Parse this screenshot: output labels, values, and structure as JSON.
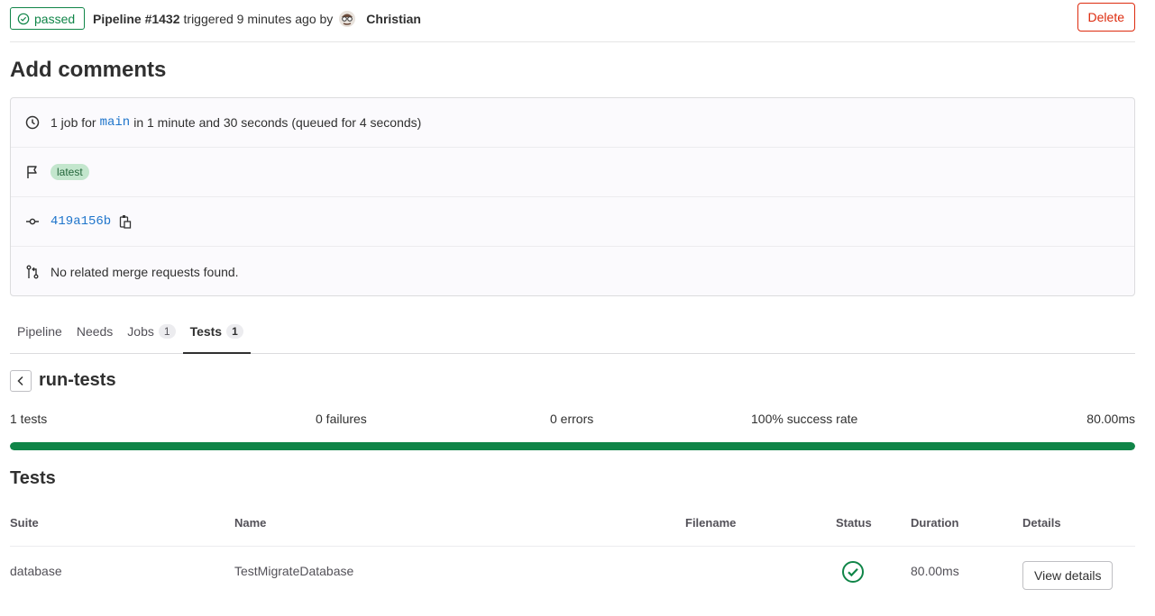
{
  "header": {
    "status": "passed",
    "pipeline_id": "Pipeline #1432",
    "triggered_text": "triggered 9 minutes ago by",
    "author": "Christian",
    "delete_label": "Delete"
  },
  "page_title": "Add comments",
  "info": {
    "job_prefix": "1 job for",
    "branch": "main",
    "job_suffix": "in 1 minute and 30 seconds (queued for 4 seconds)",
    "tag": "latest",
    "sha": "419a156b",
    "merge_requests": "No related merge requests found."
  },
  "tabs": [
    {
      "label": "Pipeline",
      "count": null
    },
    {
      "label": "Needs",
      "count": null
    },
    {
      "label": "Jobs",
      "count": "1"
    },
    {
      "label": "Tests",
      "count": "1"
    }
  ],
  "suite": {
    "name": "run-tests",
    "tests": "1 tests",
    "failures": "0 failures",
    "errors": "0 errors",
    "success_rate": "100% success rate",
    "duration": "80.00ms",
    "success_fraction": 1.0
  },
  "tests_title": "Tests",
  "table": {
    "headers": [
      "Suite",
      "Name",
      "Filename",
      "Status",
      "Duration",
      "Details"
    ],
    "rows": [
      {
        "suite": "database",
        "name": "TestMigrateDatabase",
        "filename": "",
        "status": "passed",
        "duration": "80.00ms",
        "details_label": "View details"
      }
    ]
  },
  "colors": {
    "success": "#108548",
    "danger": "#dd2b0e",
    "link": "#1f75cb"
  }
}
